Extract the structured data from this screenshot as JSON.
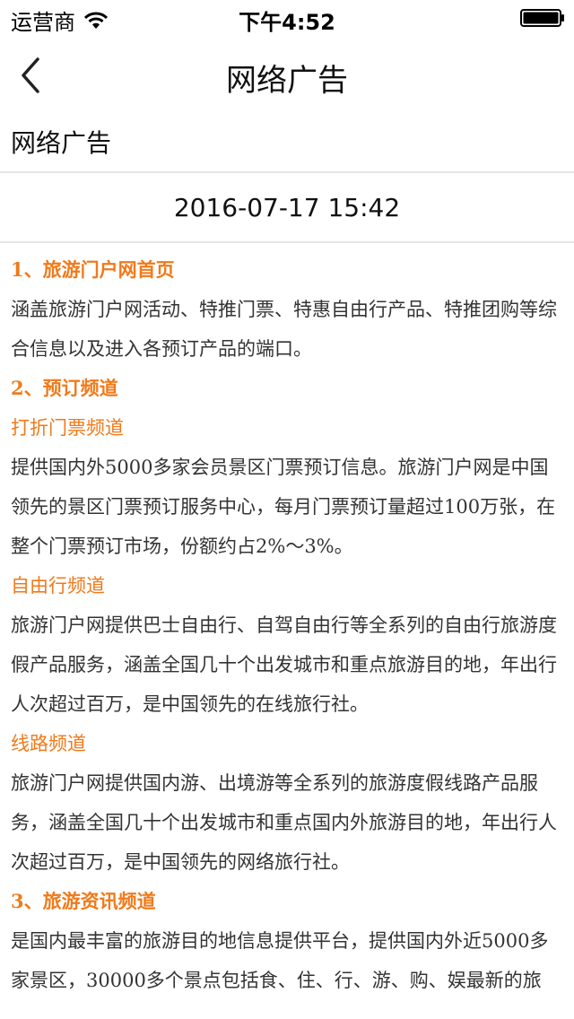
{
  "status_bar": {
    "carrier": "运营商",
    "time": "下午4:52"
  },
  "nav": {
    "title": "网络广告"
  },
  "article": {
    "heading": "网络广告",
    "timestamp": "2016-07-17 15:42",
    "blocks": [
      {
        "type": "heading-bold",
        "text": "1、旅游门户网首页"
      },
      {
        "type": "paragraph",
        "text": "涵盖旅游门户网活动、特推门票、特惠自由行产品、特推团购等综合信息以及进入各预订产品的端口。"
      },
      {
        "type": "heading-bold",
        "text": "2、预订频道"
      },
      {
        "type": "heading-sub",
        "text": "打折门票频道"
      },
      {
        "type": "paragraph",
        "text": "提供国内外5000多家会员景区门票预订信息。旅游门户网是中国领先的景区门票预订服务中心，每月门票预订量超过100万张，在整个门票预订市场，份额约占2%～3%。"
      },
      {
        "type": "heading-sub",
        "text": "自由行频道"
      },
      {
        "type": "paragraph",
        "text": "旅游门户网提供巴士自由行、自驾自由行等全系列的自由行旅游度假产品服务，涵盖全国几十个出发城市和重点旅游目的地，年出行人次超过百万，是中国领先的在线旅行社。"
      },
      {
        "type": "heading-sub",
        "text": "线路频道"
      },
      {
        "type": "paragraph",
        "text": "旅游门户网提供国内游、出境游等全系列的旅游度假线路产品服务，涵盖全国几十个出发城市和重点国内外旅游目的地，年出行人次超过百万，是中国领先的网络旅行社。"
      },
      {
        "type": "heading-bold",
        "text": "3、旅游资讯频道"
      },
      {
        "type": "paragraph",
        "text": "是国内最丰富的旅游目的地信息提供平台，提供国内外近5000多家景区，30000多个景点包括食、住、行、游、购、娱最新的旅"
      }
    ]
  }
}
